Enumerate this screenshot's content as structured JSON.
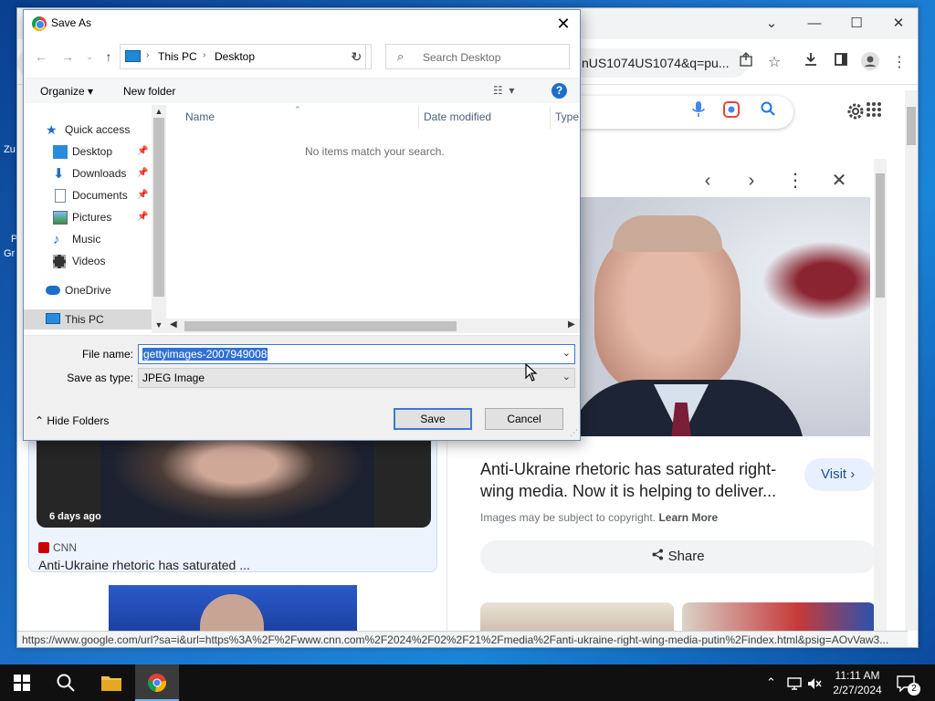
{
  "desktop": {
    "frag1": "Zu",
    "frag2": "P",
    "frag3": "Gr"
  },
  "browser": {
    "window_controls": {
      "chevron": "⌄",
      "minimize": "—",
      "maximize": "☐",
      "close": "✕"
    },
    "address_url": "nUS1074US1074&q=pu...",
    "status_url": "https://www.google.com/url?sa=i&url=https%3A%2F%2Fwww.cnn.com%2F2024%2F02%2F21%2Fmedia%2Fanti-ukraine-right-wing-media-putin%2Findex.html&psig=AOvVaw3...",
    "result_card": {
      "age": "6 days ago",
      "source": "CNN",
      "title": "Anti-Ukraine rhetoric has saturated ..."
    },
    "panel": {
      "title": "Anti-Ukraine rhetoric has saturated right-wing media. Now it is helping to deliver...",
      "visit_label": "Visit",
      "copyright_text": "Images may be subject to copyright.",
      "learn_more": "Learn More",
      "share_label": "Share"
    }
  },
  "dialog": {
    "title": "Save As",
    "breadcrumb": [
      "This PC",
      "Desktop"
    ],
    "search_placeholder": "Search Desktop",
    "organize_label": "Organize",
    "new_folder_label": "New folder",
    "nav_items": [
      {
        "label": "Quick access",
        "icon": "star-icon"
      },
      {
        "label": "Desktop",
        "icon": "desktop-folder-icon",
        "pinned": true
      },
      {
        "label": "Downloads",
        "icon": "download-icon",
        "pinned": true
      },
      {
        "label": "Documents",
        "icon": "documents-icon",
        "pinned": true
      },
      {
        "label": "Pictures",
        "icon": "pictures-icon",
        "pinned": true
      },
      {
        "label": "Music",
        "icon": "music-icon"
      },
      {
        "label": "Videos",
        "icon": "videos-icon"
      },
      {
        "label": "OneDrive",
        "icon": "cloud-icon"
      },
      {
        "label": "This PC",
        "icon": "pc-icon",
        "selected": true
      }
    ],
    "columns": [
      "Name",
      "Date modified",
      "Type"
    ],
    "empty_message": "No items match your search.",
    "file_name_label": "File name:",
    "file_name_value": "gettyimages-2007949008",
    "save_type_label": "Save as type:",
    "save_type_value": "JPEG Image",
    "hide_folders_label": "Hide Folders",
    "save_label": "Save",
    "cancel_label": "Cancel"
  },
  "taskbar": {
    "time": "11:11 AM",
    "date": "2/27/2024",
    "notification_count": "2"
  },
  "colors": {
    "accent": "#3271d4",
    "google_blue": "#1a73e8",
    "cnn_red": "#cc0000"
  }
}
